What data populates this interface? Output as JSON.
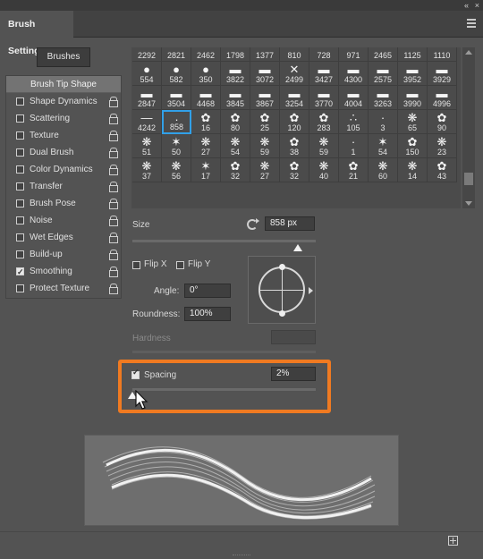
{
  "window": {
    "collapse_glyph": "«",
    "close_glyph": "×",
    "tab_title": "Brush Settings"
  },
  "brushes_button": "Brushes",
  "sidebar": {
    "header": "Brush Tip Shape",
    "items": [
      {
        "label": "Shape Dynamics",
        "checked": false
      },
      {
        "label": "Scattering",
        "checked": false
      },
      {
        "label": "Texture",
        "checked": false
      },
      {
        "label": "Dual Brush",
        "checked": false
      },
      {
        "label": "Color Dynamics",
        "checked": false
      },
      {
        "label": "Transfer",
        "checked": false
      },
      {
        "label": "Brush Pose",
        "checked": false
      },
      {
        "label": "Noise",
        "checked": false
      },
      {
        "label": "Wet Edges",
        "checked": false
      },
      {
        "label": "Build-up",
        "checked": false
      },
      {
        "label": "Smoothing",
        "checked": true
      },
      {
        "label": "Protect Texture",
        "checked": false
      }
    ]
  },
  "brush_grid": {
    "selected": "858",
    "rows": [
      [
        "2292",
        "2821",
        "2462",
        "1798",
        "1377",
        "810",
        "728",
        "971",
        "2465",
        "1125",
        "1110"
      ],
      [
        "554",
        "582",
        "350",
        "3822",
        "3072",
        "2499",
        "3427",
        "4300",
        "2575",
        "3952",
        "3929"
      ],
      [
        "2847",
        "3504",
        "4468",
        "3845",
        "3867",
        "3254",
        "3770",
        "4004",
        "3263",
        "3990",
        "4996"
      ],
      [
        "4242",
        "858",
        "16",
        "80",
        "25",
        "120",
        "283",
        "105",
        "3",
        "65",
        "90"
      ],
      [
        "51",
        "50",
        "27",
        "54",
        "59",
        "38",
        "59",
        "1",
        "54",
        "150",
        "23"
      ],
      [
        "37",
        "56",
        "17",
        "32",
        "27",
        "32",
        "40",
        "21",
        "60",
        "14",
        "43"
      ]
    ],
    "glyphs": [
      [
        "",
        "",
        "",
        "",
        "",
        "",
        "",
        "",
        "",
        "",
        ""
      ],
      [
        "●",
        "●",
        "●",
        "▬",
        "▬",
        "✕",
        "▬",
        "▬",
        "▬",
        "▬",
        "▬"
      ],
      [
        "▬",
        "▬",
        "▬",
        "▬",
        "▬",
        "▬",
        "▬",
        "▬",
        "▬",
        "▬",
        "▬"
      ],
      [
        "—",
        "·",
        "✿",
        "✿",
        "✿",
        "✿",
        "✿",
        "∴",
        "·",
        "❋",
        "✿"
      ],
      [
        "❋",
        "✶",
        "❋",
        "❋",
        "❋",
        "✿",
        "❋",
        "·",
        "✶",
        "✿",
        "❋"
      ],
      [
        "❋",
        "❋",
        "✶",
        "✿",
        "❋",
        "✿",
        "❋",
        "✿",
        "❋",
        "❋",
        "✿"
      ]
    ]
  },
  "size": {
    "label": "Size",
    "value": "858 px",
    "slider_fraction": 0.9
  },
  "flip_x": {
    "label": "Flip X",
    "checked": false
  },
  "flip_y": {
    "label": "Flip Y",
    "checked": false
  },
  "angle": {
    "label": "Angle:",
    "value": "0°"
  },
  "roundness": {
    "label": "Roundness:",
    "value": "100%"
  },
  "hardness": {
    "label": "Hardness",
    "value": ""
  },
  "spacing": {
    "label": "Spacing",
    "value": "2%",
    "checked": true,
    "slider_fraction": 0.0
  },
  "colors": {
    "highlight": "#f07a21",
    "selection": "#31a0e8",
    "panel_bg": "#535353"
  }
}
